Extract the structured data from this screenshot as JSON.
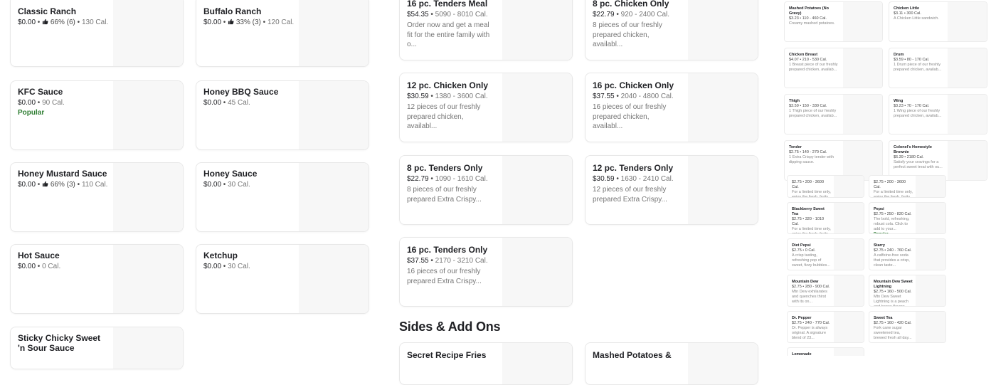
{
  "sauces": [
    {
      "name": "Classic Ranch",
      "price": "$0.00",
      "rating": "66% (6)",
      "cal": "130 Cal."
    },
    {
      "name": "Buffalo Ranch",
      "price": "$0.00",
      "rating": "33% (3)",
      "cal": "120 Cal."
    },
    {
      "name": "KFC Sauce",
      "price": "$0.00",
      "cal": "90 Cal.",
      "badge": "Popular"
    },
    {
      "name": "Honey BBQ Sauce",
      "price": "$0.00",
      "cal": "45 Cal."
    },
    {
      "name": "Honey Mustard Sauce",
      "price": "$0.00",
      "rating": "66% (3)",
      "cal": "110 Cal."
    },
    {
      "name": "Honey Sauce",
      "price": "$0.00",
      "cal": "30 Cal."
    },
    {
      "name": "Hot Sauce",
      "price": "$0.00",
      "cal": "0 Cal."
    },
    {
      "name": "Ketchup",
      "price": "$0.00",
      "cal": "30 Cal."
    },
    {
      "name": "Sticky Chicky Sweet 'n Sour Sauce"
    }
  ],
  "meals": [
    {
      "name": "16 pc. Tenders Meal",
      "price": "$54.35",
      "cal": "5090 - 8010 Cal.",
      "desc": "Order now and get a meal fit for the entire family with o..."
    },
    {
      "name": "8 pc. Chicken Only",
      "price": "$22.79",
      "cal": "920 - 2400 Cal.",
      "desc": "8 pieces of our freshly prepared chicken, availabl..."
    },
    {
      "name": "12 pc. Chicken Only",
      "price": "$30.59",
      "cal": "1380 - 3600 Cal.",
      "desc": "12 pieces of our freshly prepared chicken, availabl..."
    },
    {
      "name": "16 pc. Chicken Only",
      "price": "$37.55",
      "cal": "2040 - 4800 Cal.",
      "desc": "16 pieces of our freshly prepared chicken, availabl..."
    },
    {
      "name": "8 pc. Tenders Only",
      "price": "$22.79",
      "cal": "1090 - 1610 Cal.",
      "desc": "8 pieces of our freshly prepared Extra Crispy..."
    },
    {
      "name": "12 pc. Tenders Only",
      "price": "$30.59",
      "cal": "1630 - 2410 Cal.",
      "desc": "12 pieces of our freshly prepared Extra Crispy..."
    },
    {
      "name": "16 pc. Tenders Only",
      "price": "$37.55",
      "cal": "2170 - 3210 Cal.",
      "desc": "16 pieces of our freshly prepared Extra Crispy..."
    }
  ],
  "sides_title": "Sides & Add Ons",
  "sides": [
    {
      "name": "Secret Recipe Fries"
    },
    {
      "name": "Mashed Potatoes &"
    }
  ],
  "right_panel": {
    "cards_a": [
      {
        "name": "Mashed Potatoes (No Gravy)",
        "meta": "$3.23 • 110 - 460 Cal.",
        "desc": "Creamy mashed potatoes."
      },
      {
        "name": "Chicken Little",
        "meta": "$3.11 • 300 Cal.",
        "desc": "A Chicken Little sandwich."
      },
      {
        "name": "Chicken Breast",
        "meta": "$4.07 • 210 - 530 Cal.",
        "desc": "1 Breast piece of our freshly prepared chicken, availab..."
      },
      {
        "name": "Drum",
        "meta": "$3.59 • 80 - 170 Cal.",
        "desc": "1 Drum piece of our freshly prepared chicken, availab..."
      },
      {
        "name": "Thigh",
        "meta": "$3.59 • 150 - 330 Cal.",
        "desc": "1 Thigh piece of our freshly prepared chicken, availab..."
      },
      {
        "name": "Wing",
        "meta": "$3.23 • 70 - 170 Cal.",
        "desc": "1 Wing piece of our freshly prepared chicken, availab..."
      },
      {
        "name": "Tender",
        "meta": "$2.75 • 140 - 270 Cal.",
        "desc": "1 Extra Crispy tender with dipping sauce."
      },
      {
        "name": "Colonel's Homestyle Brownie",
        "meta": "$6.39 • 2180 Cal.",
        "desc": "Satisfy your cravings for a perfect sweet treat with ou..."
      }
    ],
    "cards_b": [
      {
        "name": "",
        "meta": "$2.75 • 200 - 3600 Cal.",
        "desc": "For a limited time only, enjoy the fresh, fruity flavor of..."
      },
      {
        "name": "",
        "meta": "$2.75 • 200 - 3600 Cal.",
        "desc": "For a limited time only, enjoy the fresh, fruity flavor of..."
      },
      {
        "name": "Blackberry Sweet Tea",
        "meta": "$2.75 • 320 - 1010 Cal.",
        "desc": "For a limited time only, enjoy the fresh, fruity flavor of..."
      },
      {
        "name": "Pepsi",
        "meta": "$2.75 • 250 - 820 Cal.",
        "desc": "The bold, refreshing, robust cola. Click to add to your...",
        "badge": "Popular"
      },
      {
        "name": "Diet Pepsi",
        "meta": "$2.75 • 0 Cal.",
        "desc": "A crisp tasting, refreshing pop of sweet, fizzy bubbles..."
      },
      {
        "name": "Starry",
        "meta": "$2.75 • 240 - 760 Cal.",
        "desc": "A caffeine-free soda that provides a crisp, clean taste..."
      },
      {
        "name": "Mountain Dew",
        "meta": "$2.75 • 280 - 900 Cal.",
        "desc": "Mtn Dew exhilarates and quenches thirst with its on..."
      },
      {
        "name": "Mountain Dew Sweet Lightning",
        "meta": "$2.75 • 160 - 500 Cal.",
        "desc": "Mtn Dew Sweet Lightning is a peach and honey flavore..."
      },
      {
        "name": "Dr. Pepper",
        "meta": "$2.75 • 240 - 770 Cal.",
        "desc": "Dr. Pepper is always original. A signature blend of 23..."
      },
      {
        "name": "Sweet Tea",
        "meta": "$2.75 • 160 - 420 Cal.",
        "desc": "Fork cane sugar sweetened tea, brewed fresh all day..."
      },
      {
        "name": "Lemonade",
        "meta": "",
        "desc": ""
      }
    ]
  }
}
